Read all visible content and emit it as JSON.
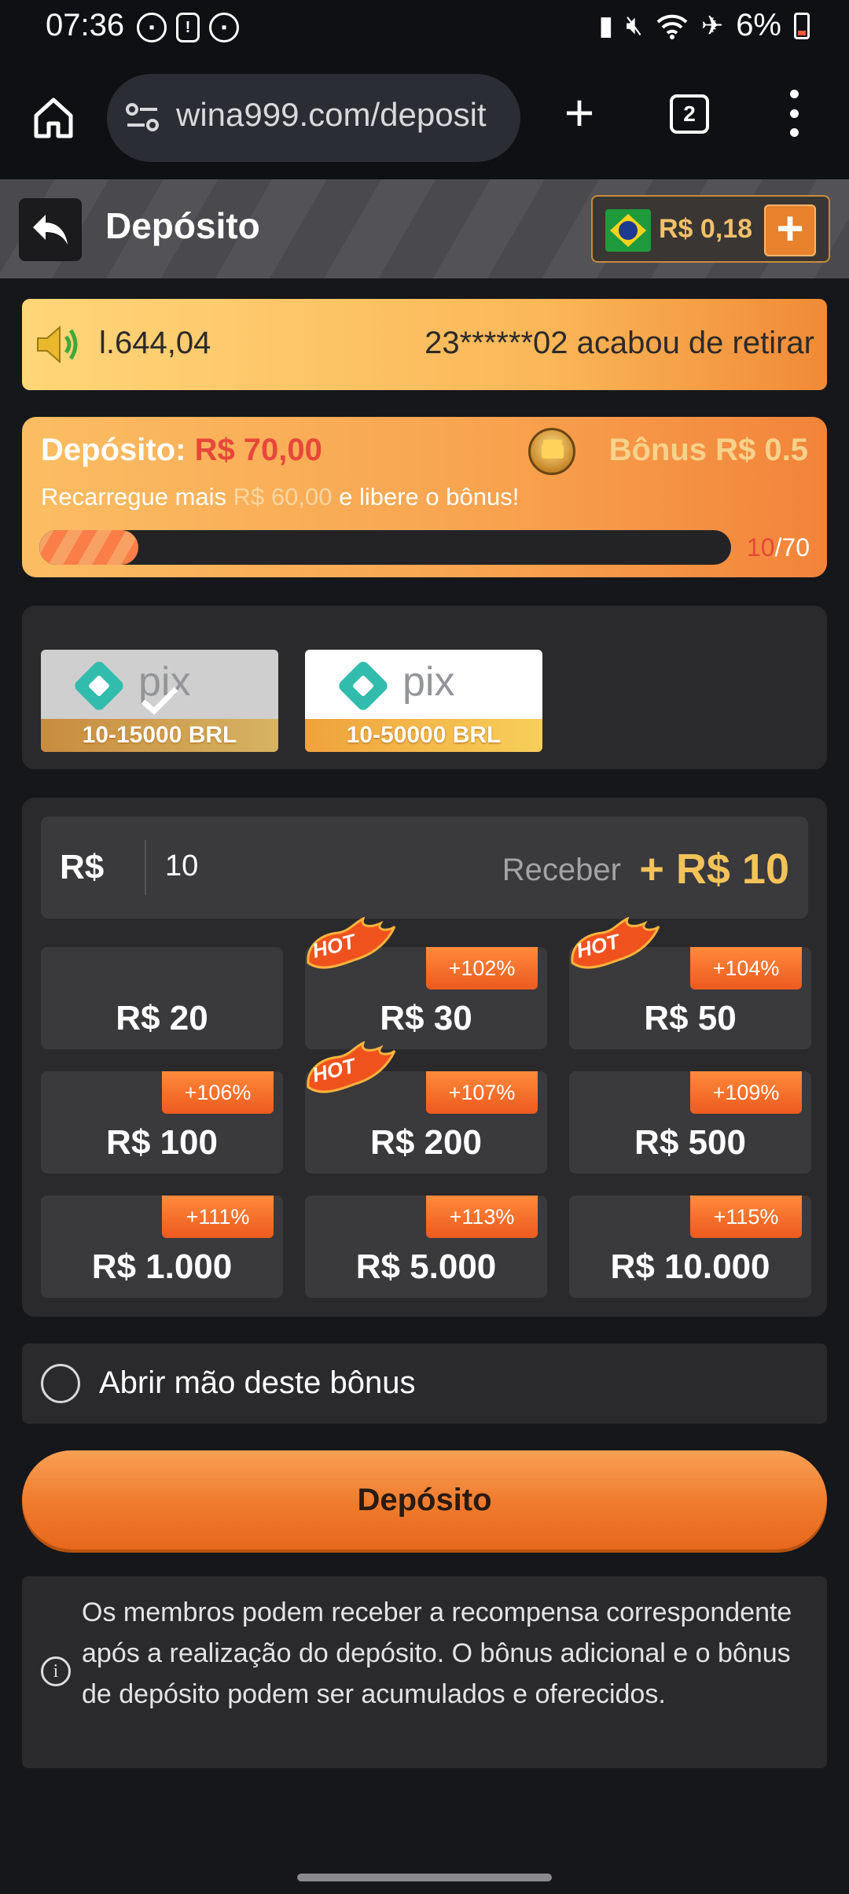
{
  "status_bar": {
    "time": "07:36",
    "battery": "6%",
    "left_icons": [
      "notification-icon",
      "alert-icon",
      "notification-icon"
    ],
    "right_icons": [
      "battery-saver-icon",
      "mute-icon",
      "wifi-icon",
      "airplane-icon",
      "battery-icon"
    ]
  },
  "browser": {
    "url": "wina999.com/deposit",
    "tab_count": "2"
  },
  "header": {
    "title": "Depósito",
    "balance": "R$ 0,18",
    "add_symbol": "+"
  },
  "marquee": {
    "left_text": "l.644,04",
    "right_text": "23******02 acabou de retirar"
  },
  "bonus": {
    "deposit_label": "Depósito:",
    "deposit_value": "R$ 70,00",
    "bonus_text": "Bônus R$ 0.5",
    "desc_prefix": "Recarregue mais",
    "desc_amount": "R$ 60,00",
    "desc_suffix": "e libere o bônus!",
    "progress_current": "10",
    "progress_total": "/70",
    "progress_fraction": 0.1429
  },
  "payment_methods": [
    {
      "name": "pix",
      "range": "10-15000 BRL",
      "selected": true
    },
    {
      "name": "pix",
      "range": "10-50000 BRL",
      "selected": false
    }
  ],
  "amount": {
    "currency": "R$",
    "value": "10",
    "receive_label": "Receber",
    "receive_value": "+ R$ 10"
  },
  "amount_options": [
    {
      "label": "R$ 20",
      "badge": "",
      "hot": false
    },
    {
      "label": "R$ 30",
      "badge": "+102%",
      "hot": true
    },
    {
      "label": "R$ 50",
      "badge": "+104%",
      "hot": true
    },
    {
      "label": "R$ 100",
      "badge": "+106%",
      "hot": false
    },
    {
      "label": "R$ 200",
      "badge": "+107%",
      "hot": true
    },
    {
      "label": "R$ 500",
      "badge": "+109%",
      "hot": false
    },
    {
      "label": "R$ 1.000",
      "badge": "+111%",
      "hot": false
    },
    {
      "label": "R$ 5.000",
      "badge": "+113%",
      "hot": false
    },
    {
      "label": "R$ 10.000",
      "badge": "+115%",
      "hot": false
    }
  ],
  "hot_label": "HOT",
  "forfeit": {
    "label": "Abrir mão deste bônus"
  },
  "deposit_button": "Depósito",
  "info": {
    "icon": "i",
    "text": "Os membros podem receber a recompensa correspondente após a realização do depósito. O bônus adicional e o bônus de depósito podem ser acumulados e oferecidos."
  },
  "colors": {
    "accent": "#ef7a2c",
    "gold": "#f3c35a",
    "red": "#e7473a",
    "panel": "#2a2a2c"
  }
}
